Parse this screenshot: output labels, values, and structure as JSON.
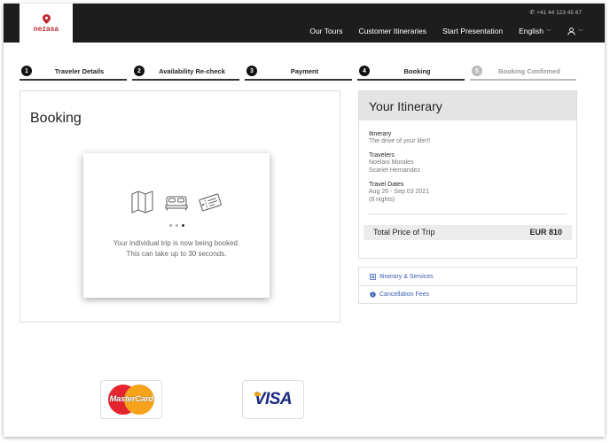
{
  "header": {
    "logo_text": "nezasa",
    "phone": "+41 44 123 45 67",
    "nav": [
      {
        "label": "Our Tours"
      },
      {
        "label": "Customer Itineraries"
      },
      {
        "label": "Start Presentation"
      },
      {
        "label": "English"
      }
    ]
  },
  "steps": [
    {
      "num": "1",
      "label": "Traveler Details",
      "state": "done"
    },
    {
      "num": "2",
      "label": "Availability Re-check",
      "state": "done"
    },
    {
      "num": "3",
      "label": "Payment",
      "state": "done"
    },
    {
      "num": "4",
      "label": "Booking",
      "state": "current"
    },
    {
      "num": "5",
      "label": "Booking Confirmed",
      "state": "pending"
    }
  ],
  "booking": {
    "title": "Booking",
    "message_line1": "Your individual trip is now being booked.",
    "message_line2": "This can take up to 30 seconds.",
    "icons": [
      "map-icon",
      "bed-icon",
      "ticket-icon"
    ]
  },
  "itinerary": {
    "title": "Your Itinerary",
    "itinerary_label": "Itinerary",
    "itinerary_value": "The drive of your life!!!",
    "travelers_label": "Travelers",
    "travelers": [
      "Noelani Morales",
      "Scarlet Hernandez"
    ],
    "dates_label": "Travel Dates",
    "dates_value": "Aug 26 - Sep 03 2021",
    "nights": "(8 nights)",
    "total_label": "Total Price of Trip",
    "total_value": "EUR 810"
  },
  "links": [
    {
      "label": "Itinerary & Services",
      "icon": "list-icon"
    },
    {
      "label": "Cancellation Fees",
      "icon": "info-icon"
    }
  ],
  "payment": {
    "mastercard_text": "MasterCard",
    "visa_text": "VISA"
  },
  "colors": {
    "header_bg": "#1d1d1d",
    "brand_red": "#c0272d",
    "link_blue": "#3a5fb0"
  }
}
